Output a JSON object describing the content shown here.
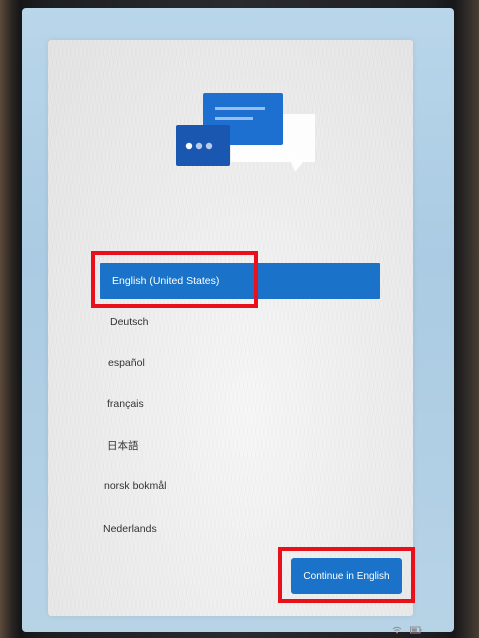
{
  "languages": {
    "items": [
      {
        "label": "English (United States)",
        "selected": true
      },
      {
        "label": "Deutsch",
        "selected": false
      },
      {
        "label": "español",
        "selected": false
      },
      {
        "label": "français",
        "selected": false
      },
      {
        "label": "日本語",
        "selected": false
      },
      {
        "label": "norsk bokmål",
        "selected": false
      },
      {
        "label": "Nederlands",
        "selected": false
      }
    ]
  },
  "actions": {
    "continue_label": "Continue in English"
  },
  "colors": {
    "accent": "#1a73c8",
    "highlight": "#e8101a",
    "screen_background": "#aacbe3",
    "card_background": "#eeeeee"
  },
  "icons": {
    "illustration": "chat-bubbles-icon",
    "tray": [
      "wifi-icon",
      "battery-icon"
    ]
  }
}
